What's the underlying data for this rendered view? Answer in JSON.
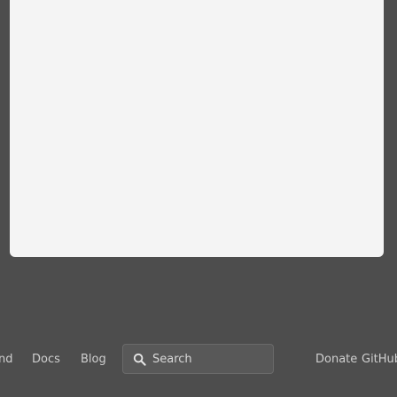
{
  "nav": {
    "partial_label": "nd",
    "links": [
      {
        "label": "Docs"
      },
      {
        "label": "Blog"
      }
    ],
    "search": {
      "label": "Search",
      "icon": "search-icon"
    },
    "right_links": [
      {
        "label": "Donate"
      },
      {
        "label": "GitHub"
      }
    ]
  },
  "colors": {
    "backdrop": "#4d4d4d",
    "modal": "#f4f4f4",
    "nav_text": "#cfcfcf",
    "search_bg": "#585858"
  }
}
